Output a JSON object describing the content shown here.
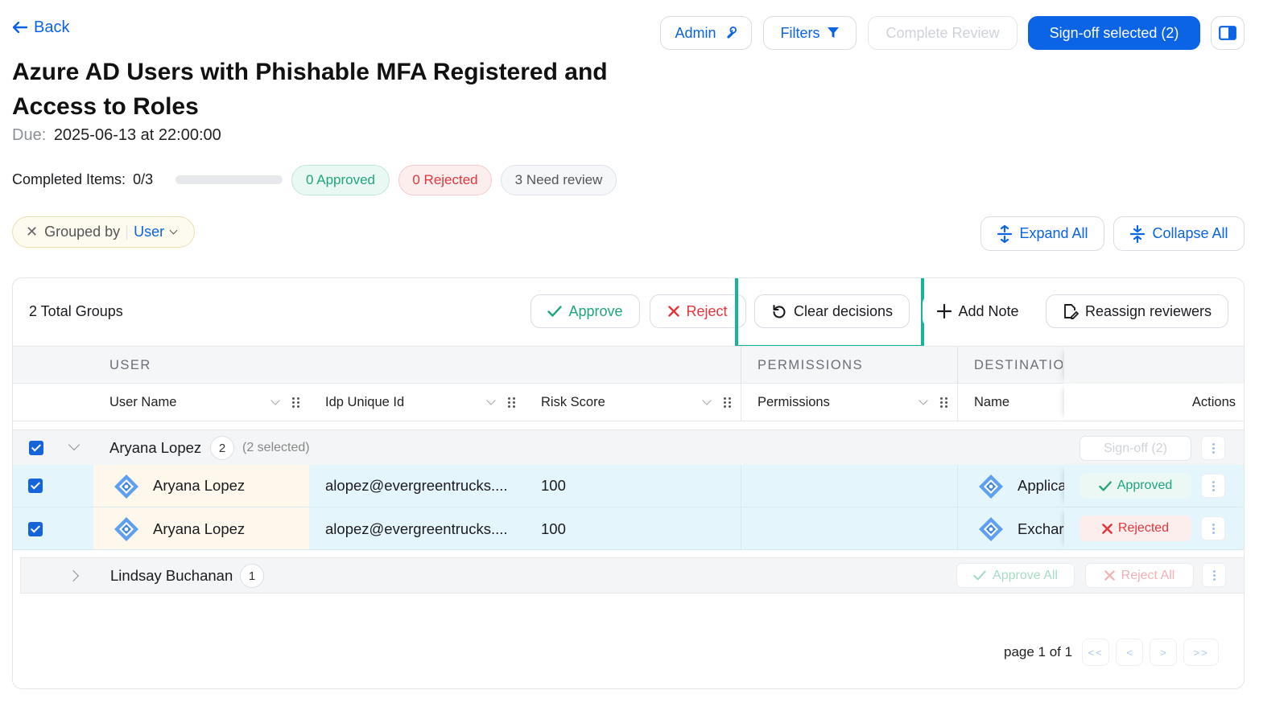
{
  "nav": {
    "back_label": "Back"
  },
  "toolbar": {
    "admin_label": "Admin",
    "filters_label": "Filters",
    "complete_review_label": "Complete Review",
    "signoff_selected_label": "Sign-off selected (2)"
  },
  "page": {
    "title_line1": "Azure AD Users with Phishable MFA Registered and",
    "title_line2": "Access to Roles",
    "due_label": "Due:",
    "due_value": "2025-06-13 at 22:00:00"
  },
  "progress": {
    "completed_label": "Completed Items:",
    "completed_value": "0/3",
    "completed_fraction": 0.0,
    "approved_label": "0 Approved",
    "rejected_label": "0 Rejected",
    "need_review_label": "3 Need review"
  },
  "grouping": {
    "grouped_by_label": "Grouped by",
    "group_field": "User"
  },
  "expand": {
    "expand_all_label": "Expand All",
    "collapse_all_label": "Collapse All"
  },
  "table_toolbar": {
    "total_groups": "2 Total Groups",
    "approve_label": "Approve",
    "reject_label": "Reject",
    "clear_decisions_label": "Clear decisions",
    "add_note_label": "Add Note",
    "reassign_label": "Reassign reviewers"
  },
  "columns": {
    "group_user": "USER",
    "group_permissions": "PERMISSIONS",
    "group_destination": "DESTINATIO",
    "user_name": "User Name",
    "idp_unique_id": "Idp Unique Id",
    "risk_score": "Risk Score",
    "permissions": "Permissions",
    "name": "Name",
    "actions": "Actions"
  },
  "groups": [
    {
      "name": "Aryana Lopez",
      "count": "2",
      "selected_text": "(2 selected)",
      "signoff_label": "Sign-off (2)",
      "rows": [
        {
          "user_name": "Aryana Lopez",
          "idp_id": "alopez@evergreentrucks....",
          "risk_score": "100",
          "permissions": "",
          "dest_name": "Applica",
          "status": "Approved"
        },
        {
          "user_name": "Aryana Lopez",
          "idp_id": "alopez@evergreentrucks....",
          "risk_score": "100",
          "permissions": "",
          "dest_name": "Exchar",
          "status": "Rejected"
        }
      ]
    },
    {
      "name": "Lindsay Buchanan",
      "count": "1",
      "approve_all_label": "Approve All",
      "reject_all_label": "Reject All"
    }
  ],
  "pagination": {
    "page_text": "page 1 of 1",
    "first_label": "<<",
    "prev_label": "<",
    "next_label": ">",
    "last_label": ">>"
  },
  "colors": {
    "primary": "#0b63e5",
    "approved": "#1fa57a",
    "rejected": "#e3353b",
    "highlight": "#18b39a"
  }
}
